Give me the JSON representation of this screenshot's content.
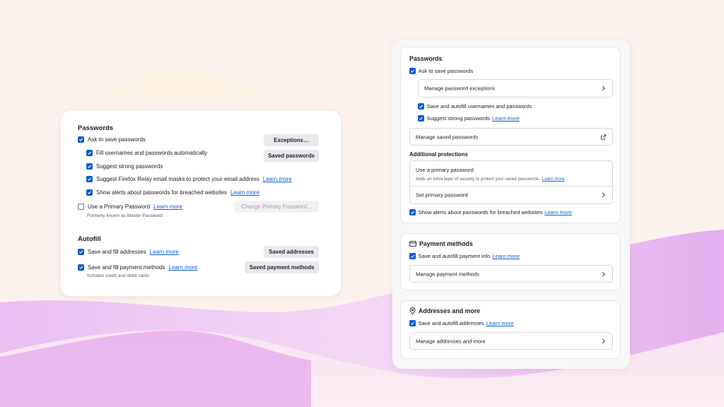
{
  "colors": {
    "accent": "#0a5bd3",
    "link": "#0b61d8",
    "background": "#fbf1ed",
    "wave": "#e8b5f0"
  },
  "old": {
    "passwords_heading": "Passwords",
    "ask_save": "Ask to save passwords",
    "fill_auto": "Fill usernames and passwords automatically",
    "suggest_strong": "Suggest strong passwords",
    "relay": "Suggest Firefox Relay email masks to protect your email address",
    "breach_alerts": "Show alerts about passwords for breached websites",
    "primary_pw": "Use a Primary Password",
    "primary_pw_sub": "Formerly known as Master Password",
    "learn_more": "Learn more",
    "btn_exceptions": "Exceptions…",
    "btn_saved_passwords": "Saved passwords",
    "btn_change_primary": "Change Primary Password…",
    "autofill_heading": "Autofill",
    "save_addresses": "Save and fill addresses",
    "save_payment": "Save and fill payment methods",
    "payment_sub": "Includes credit and debit cards",
    "btn_saved_addresses": "Saved addresses",
    "btn_saved_payment": "Saved payment methods",
    "checked": {
      "ask_save": true,
      "fill_auto": true,
      "suggest_strong": true,
      "relay": true,
      "breach_alerts": true,
      "primary_pw": false,
      "save_addresses": true,
      "save_payment": true
    }
  },
  "new": {
    "passwords_heading": "Passwords",
    "ask_save": "Ask to save passwords",
    "manage_exceptions": "Manage password exceptions",
    "save_autofill": "Save and autofill usernames and passwords",
    "suggest_strong": "Suggest strong passwords",
    "learn_more": "Learn more",
    "manage_saved": "Manage saved passwords",
    "additional_heading": "Additional protections",
    "primary_title": "Use a primary password",
    "primary_desc": "Adds an extra layer of security to protect your saved passwords.",
    "set_primary": "Set primary password",
    "breach_alerts": "Show alerts about passwords for breached websites",
    "payment_heading": "Payment methods",
    "payment_save": "Save and autofill payment info",
    "manage_payment": "Manage payment methods",
    "addresses_heading": "Addresses and more",
    "addresses_save": "Save and autofill addresses",
    "manage_addresses": "Manage addresses and more",
    "icons": {
      "chevron": "chevron-right-icon",
      "external": "external-link-icon",
      "card": "credit-card-icon",
      "location": "location-pin-icon"
    }
  }
}
